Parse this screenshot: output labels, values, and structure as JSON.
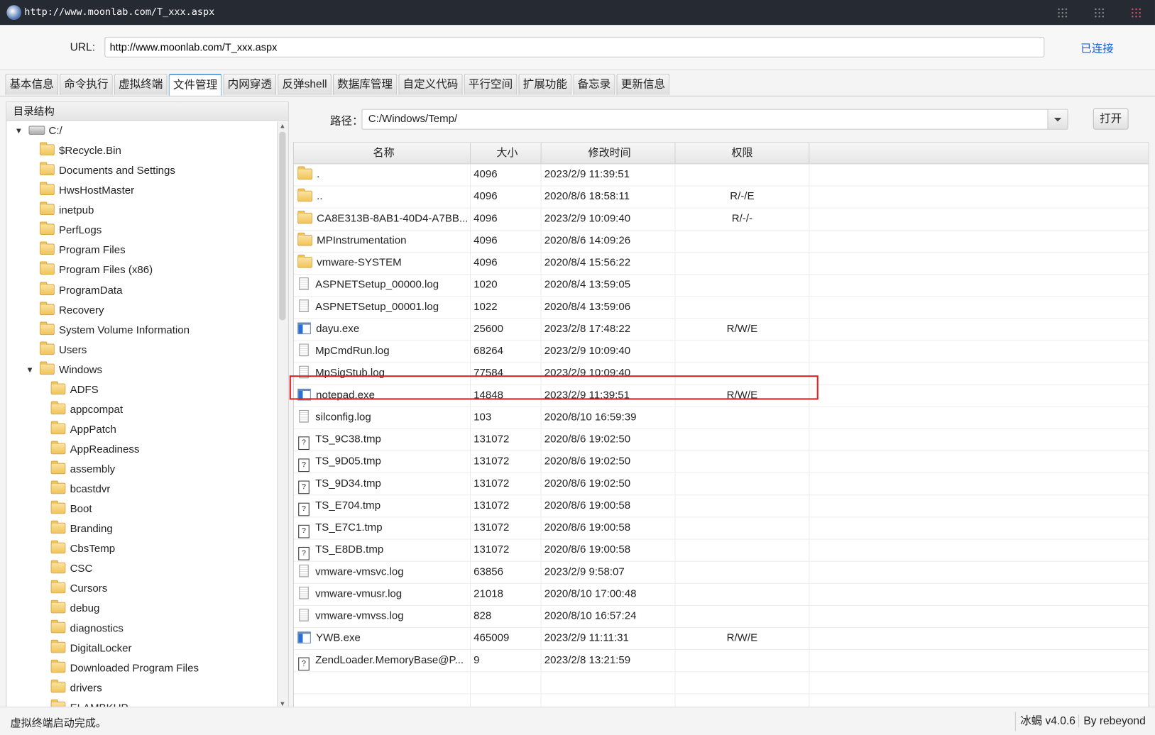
{
  "window": {
    "title": "http://www.moonlab.com/T_xxx.aspx"
  },
  "url_bar": {
    "label": "URL:",
    "value": "http://www.moonlab.com/T_xxx.aspx",
    "status": "已连接"
  },
  "tabs": [
    {
      "label": "基本信息"
    },
    {
      "label": "命令执行"
    },
    {
      "label": "虚拟终端"
    },
    {
      "label": "文件管理",
      "active": true
    },
    {
      "label": "内网穿透"
    },
    {
      "label": "反弹shell"
    },
    {
      "label": "数据库管理"
    },
    {
      "label": "自定义代码"
    },
    {
      "label": "平行空间"
    },
    {
      "label": "扩展功能"
    },
    {
      "label": "备忘录"
    },
    {
      "label": "更新信息"
    }
  ],
  "tree": {
    "header": "目录结构",
    "items": [
      {
        "label": "C:/",
        "level": 0,
        "expanded": true,
        "type": "disk"
      },
      {
        "label": "$Recycle.Bin",
        "level": 1
      },
      {
        "label": "Documents and Settings",
        "level": 1
      },
      {
        "label": "HwsHostMaster",
        "level": 1
      },
      {
        "label": "inetpub",
        "level": 1
      },
      {
        "label": "PerfLogs",
        "level": 1
      },
      {
        "label": "Program Files",
        "level": 1
      },
      {
        "label": "Program Files (x86)",
        "level": 1
      },
      {
        "label": "ProgramData",
        "level": 1
      },
      {
        "label": "Recovery",
        "level": 1
      },
      {
        "label": "System Volume Information",
        "level": 1
      },
      {
        "label": "Users",
        "level": 1
      },
      {
        "label": "Windows",
        "level": 1,
        "expanded": true
      },
      {
        "label": "ADFS",
        "level": 2
      },
      {
        "label": "appcompat",
        "level": 2
      },
      {
        "label": "AppPatch",
        "level": 2
      },
      {
        "label": "AppReadiness",
        "level": 2
      },
      {
        "label": "assembly",
        "level": 2
      },
      {
        "label": "bcastdvr",
        "level": 2
      },
      {
        "label": "Boot",
        "level": 2
      },
      {
        "label": "Branding",
        "level": 2
      },
      {
        "label": "CbsTemp",
        "level": 2
      },
      {
        "label": "CSC",
        "level": 2
      },
      {
        "label": "Cursors",
        "level": 2
      },
      {
        "label": "debug",
        "level": 2
      },
      {
        "label": "diagnostics",
        "level": 2
      },
      {
        "label": "DigitalLocker",
        "level": 2
      },
      {
        "label": "Downloaded Program Files",
        "level": 2
      },
      {
        "label": "drivers",
        "level": 2
      },
      {
        "label": "ELAMBKUP",
        "level": 2
      }
    ]
  },
  "path": {
    "label": "路径：",
    "value": "C:/Windows/Temp/",
    "open_button": "打开"
  },
  "files": {
    "columns": [
      "名称",
      "大小",
      "修改时间",
      "权限"
    ],
    "highlight_color": "#e02020",
    "rows": [
      {
        "name": ".",
        "size": "4096",
        "mtime": "2023/2/9 11:39:51",
        "perm": "",
        "icon": "folder"
      },
      {
        "name": "..",
        "size": "4096",
        "mtime": "2020/8/6 18:58:11",
        "perm": "R/-/E",
        "icon": "folder"
      },
      {
        "name": "CA8E313B-8AB1-40D4-A7BB...",
        "size": "4096",
        "mtime": "2023/2/9 10:09:40",
        "perm": "R/-/-",
        "icon": "folder"
      },
      {
        "name": "MPInstrumentation",
        "size": "4096",
        "mtime": "2020/8/6 14:09:26",
        "perm": "",
        "icon": "folder"
      },
      {
        "name": "vmware-SYSTEM",
        "size": "4096",
        "mtime": "2020/8/4 15:56:22",
        "perm": "",
        "icon": "folder"
      },
      {
        "name": "ASPNETSetup_00000.log",
        "size": "1020",
        "mtime": "2020/8/4 13:59:05",
        "perm": "",
        "icon": "log"
      },
      {
        "name": "ASPNETSetup_00001.log",
        "size": "1022",
        "mtime": "2020/8/4 13:59:06",
        "perm": "",
        "icon": "log"
      },
      {
        "name": "dayu.exe",
        "size": "25600",
        "mtime": "2023/2/8 17:48:22",
        "perm": "R/W/E",
        "icon": "exe"
      },
      {
        "name": "MpCmdRun.log",
        "size": "68264",
        "mtime": "2023/2/9 10:09:40",
        "perm": "",
        "icon": "log"
      },
      {
        "name": "MpSigStub.log",
        "size": "77584",
        "mtime": "2023/2/9 10:09:40",
        "perm": "",
        "icon": "log"
      },
      {
        "name": "notepad.exe",
        "size": "14848",
        "mtime": "2023/2/9 11:39:51",
        "perm": "R/W/E",
        "icon": "exe",
        "highlighted": true
      },
      {
        "name": "silconfig.log",
        "size": "103",
        "mtime": "2020/8/10 16:59:39",
        "perm": "",
        "icon": "log"
      },
      {
        "name": "TS_9C38.tmp",
        "size": "131072",
        "mtime": "2020/8/6 19:02:50",
        "perm": "",
        "icon": "tmp"
      },
      {
        "name": "TS_9D05.tmp",
        "size": "131072",
        "mtime": "2020/8/6 19:02:50",
        "perm": "",
        "icon": "tmp"
      },
      {
        "name": "TS_9D34.tmp",
        "size": "131072",
        "mtime": "2020/8/6 19:02:50",
        "perm": "",
        "icon": "tmp"
      },
      {
        "name": "TS_E704.tmp",
        "size": "131072",
        "mtime": "2020/8/6 19:00:58",
        "perm": "",
        "icon": "tmp"
      },
      {
        "name": "TS_E7C1.tmp",
        "size": "131072",
        "mtime": "2020/8/6 19:00:58",
        "perm": "",
        "icon": "tmp"
      },
      {
        "name": "TS_E8DB.tmp",
        "size": "131072",
        "mtime": "2020/8/6 19:00:58",
        "perm": "",
        "icon": "tmp"
      },
      {
        "name": "vmware-vmsvc.log",
        "size": "63856",
        "mtime": "2023/2/9 9:58:07",
        "perm": "",
        "icon": "log"
      },
      {
        "name": "vmware-vmusr.log",
        "size": "21018",
        "mtime": "2020/8/10 17:00:48",
        "perm": "",
        "icon": "log"
      },
      {
        "name": "vmware-vmvss.log",
        "size": "828",
        "mtime": "2020/8/10 16:57:24",
        "perm": "",
        "icon": "log"
      },
      {
        "name": "YWB.exe",
        "size": "465009",
        "mtime": "2023/2/9 11:11:31",
        "perm": "R/W/E",
        "icon": "exe"
      },
      {
        "name": "ZendLoader.MemoryBase@P...",
        "size": "9",
        "mtime": "2023/2/8 13:21:59",
        "perm": "",
        "icon": "tmp"
      }
    ]
  },
  "status_bar": {
    "message": "虚拟终端启动完成。",
    "version": "冰蝎 v4.0.6",
    "author": "By rebeyond"
  }
}
